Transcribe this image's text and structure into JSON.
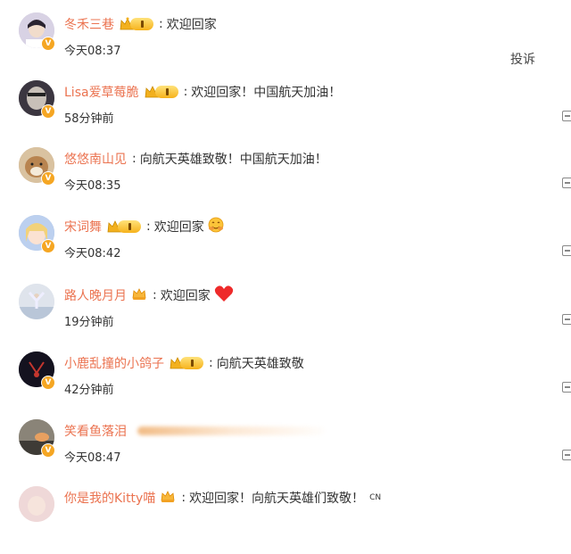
{
  "comments": [
    {
      "username": "冬禾三巷",
      "badge": "crown-level",
      "text": "欢迎回家",
      "emoji": "",
      "time": "今天08:37",
      "vip": "V",
      "avatar_color": "#c9c0d8"
    },
    {
      "username": "Lisa爱草莓脆",
      "badge": "crown-level",
      "text": "欢迎回家！中国航天加油！",
      "emoji": "",
      "time": "58分钟前",
      "vip": "V",
      "avatar_color": "#5a5560"
    },
    {
      "username": "悠悠南山见",
      "badge": "",
      "text": "向航天英雄致敬！中国航天加油！",
      "emoji": "",
      "time": "今天08:35",
      "vip": "V",
      "avatar_color": "#c7a078"
    },
    {
      "username": "宋词舞",
      "badge": "crown-level",
      "text": "欢迎回家",
      "emoji": "hug-face",
      "time": "今天08:42",
      "vip": "V",
      "avatar_color": "#9fb2d8"
    },
    {
      "username": "路人晚月月",
      "badge": "small-crown",
      "text": "欢迎回家",
      "emoji": "red-heart",
      "time": "19分钟前",
      "vip": "",
      "avatar_color": "#d7dde6"
    },
    {
      "username": "小鹿乱撞的小鸽子",
      "badge": "crown-level",
      "text": "向航天英雄致敬",
      "emoji": "",
      "time": "42分钟前",
      "vip": "V",
      "avatar_color": "#1c1a2e"
    },
    {
      "username": "笑看鱼落泪",
      "badge": "",
      "text": "",
      "emoji": "",
      "time": "今天08:47",
      "vip": "V",
      "avatar_color": "#7c7468"
    },
    {
      "username": "你是我的Kitty喵",
      "badge": "small-crown",
      "text": "欢迎回家！向航天英雄们致敬！",
      "emoji": "",
      "time": "",
      "vip": "",
      "avatar_color": "#e8cfd0",
      "suffix": "CN"
    }
  ],
  "report_label": "投诉",
  "colors": {
    "username": "#eb7350",
    "text": "#333333",
    "badge_gold": "#f5a623"
  }
}
